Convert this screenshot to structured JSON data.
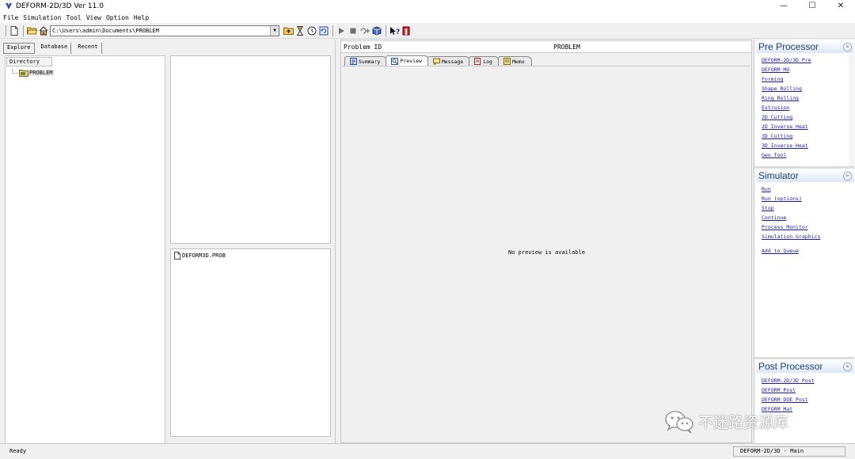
{
  "window": {
    "title": "DEFORM-2D/3D  Ver 11.0",
    "controls": {
      "minimize": "—",
      "maximize": "☐",
      "close": "✕"
    }
  },
  "menubar": [
    "File",
    "Simulation",
    "Tool",
    "View",
    "Option",
    "Help"
  ],
  "toolbar": {
    "path_value": "C:\\Users\\admin\\Documents\\PROBLEM",
    "icons": [
      "new-file-icon",
      "open-folder-icon",
      "home-icon",
      "folder-up-icon",
      "hourglass-icon",
      "clock-icon",
      "refresh-icon",
      "play-icon",
      "stop-icon",
      "step-icon",
      "cube-icon",
      "help-icon",
      "exit-icon"
    ]
  },
  "left_tabs": [
    "Explore",
    "Database",
    "Recent"
  ],
  "directory": {
    "header": "Directory",
    "root": "PROBLEM"
  },
  "files": [
    "DEFORM3D.PROB"
  ],
  "center": {
    "problem_id_label": "Problem ID",
    "problem_id_value": "PROBLEM",
    "tabs": [
      "Summary",
      "Preview",
      "Message",
      "Log",
      "Memo"
    ],
    "active_tab": "Preview",
    "preview_text": "No preview is available"
  },
  "right": {
    "pre_processor": {
      "title": "Pre Processor",
      "links": [
        "DEFORM-2D/3D Pre",
        "DEFORM MO",
        "Forming",
        "Shape Rolling",
        "Ring Rolling",
        "Extrusion",
        "2D Cutting",
        "2D Inverse Heat",
        "3D Cutting",
        "3D Inverse Heat",
        "Geo Tool"
      ]
    },
    "simulator": {
      "title": "Simulator",
      "links": [
        "Run",
        "Run (options)",
        "Stop",
        "Continue",
        "Process Monitor",
        "Simulation Graphics"
      ],
      "queue_link": "Add to Queue"
    },
    "post_processor": {
      "title": "Post Processor",
      "links": [
        "DEFORM-2D/3D Post",
        "DEFORM Post",
        "DEFORM DOE Post",
        "DEFORM Mat"
      ]
    }
  },
  "statusbar": {
    "left": "Ready",
    "right": "DEFORM-2D/3D  -  Main"
  },
  "watermark": "不迷路资源库",
  "colors": {
    "link": "#1a1aa8",
    "section_title": "#1f3d7a",
    "header_gradient": "#dce6f7"
  }
}
